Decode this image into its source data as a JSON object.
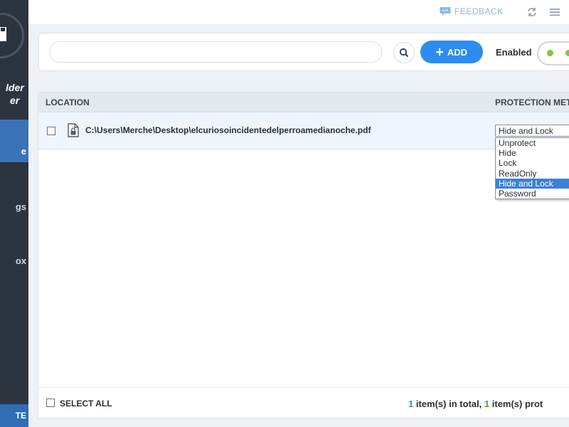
{
  "sidebar": {
    "app_name_line1": "lder",
    "app_name_line2": "er",
    "items": [
      {
        "label": "e",
        "active": true
      },
      {
        "label": "gs",
        "active": false
      },
      {
        "label": "ox",
        "active": false
      }
    ],
    "upgrade_label": "TE"
  },
  "topbar": {
    "feedback_label": "FEEDBACK",
    "icons": [
      "chat-bubble-icon",
      "refresh-icon",
      "menu-icon"
    ]
  },
  "toolbar": {
    "search_value": "",
    "add_label": "ADD",
    "enabled_label": "Enabled",
    "accent_color": "#2d8cf0"
  },
  "table": {
    "columns": {
      "location": "LOCATION",
      "method": "PROTECTION METHOD"
    },
    "rows": [
      {
        "path": "C:\\Users\\Merche\\Desktop\\elcuriosoincidentedelperroamedianoche.pdf",
        "method": "Hide and Lock"
      }
    ],
    "dropdown_options": [
      "Unprotect",
      "Hide",
      "Lock",
      "ReadOnly",
      "Hide and Lock",
      "Password"
    ],
    "dropdown_selected": "Hide and Lock"
  },
  "footer": {
    "select_all_label": "SELECT ALL",
    "total_count": "1",
    "total_text": " item(s) in total, ",
    "protected_count": "1",
    "protected_text": " item(s) prot"
  },
  "colors": {
    "sidebar_bg": "#2c3440",
    "active_nav": "#3a72b8",
    "count_blue": "#2d8cf0",
    "count_green": "#4aa71d",
    "toggle_on": "#7dc640"
  }
}
